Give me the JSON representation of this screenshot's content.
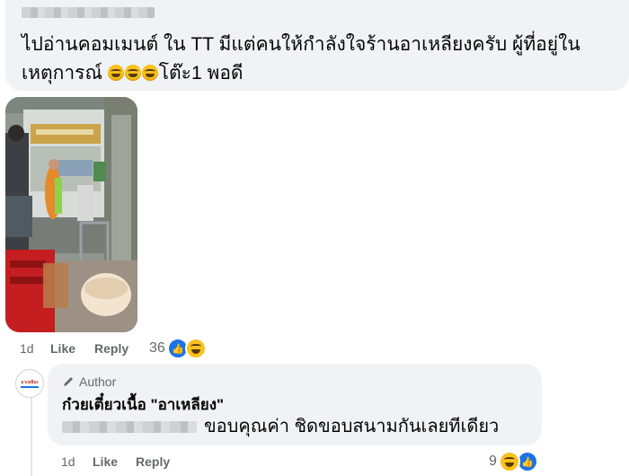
{
  "comment1": {
    "text_line1": "ไปอ่านคอมเมนต์ ใน TT มีแต่คนให้กำลังใจร้านอาเหลียงครับ ผู้ที่อยู่ใน",
    "text_line2_before": "เหตุการณ์ ",
    "emoji": "laughing-face",
    "text_line2_after": "โต๊ะ1 พอดี",
    "time": "1d",
    "like_label": "Like",
    "reply_label": "Reply",
    "reaction_count": "36"
  },
  "reply": {
    "author_badge": "Author",
    "page_name": "ก๋วยเตี๋ยวเนื้อ \"อาเหลียง\"",
    "text": "ขอบคุณค่า ชิดขอบสนามกันเลยทีเดียว",
    "time": "1d",
    "like_label": "Like",
    "reply_label": "Reply",
    "reaction_count": "9"
  },
  "colors": {
    "bubble": "#f0f2f5",
    "meta_text": "#65676b",
    "like_blue": "#1b74e4",
    "haha_yellow": "#f7c11e"
  }
}
